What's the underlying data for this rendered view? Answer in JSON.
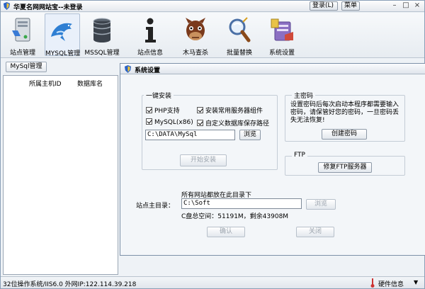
{
  "window": {
    "title": "华夏名网网站宝--未登录",
    "login_label": "登录(L)",
    "menu_label": "菜单",
    "min_glyph": "–",
    "max_glyph": "□",
    "close_glyph": "×"
  },
  "toolbar": {
    "items": [
      {
        "label": "站点管理",
        "icon": "server-icon"
      },
      {
        "label": "MYSQL管理",
        "icon": "dolphin-icon"
      },
      {
        "label": "MSSQL管理",
        "icon": "database-icon"
      },
      {
        "label": "站点信息",
        "icon": "info-icon"
      },
      {
        "label": "木马查杀",
        "icon": "horse-icon"
      },
      {
        "label": "批量替换",
        "icon": "magnifier-icon"
      },
      {
        "label": "系统设置",
        "icon": "settings-icon"
      }
    ],
    "active_index": 1
  },
  "left_panel": {
    "tab_label": "MySql管理",
    "columns": [
      "所属主机ID",
      "数据库名"
    ]
  },
  "dialog": {
    "title": "系统设置",
    "install_group": {
      "label": "一键安装",
      "options": [
        {
          "label": "PHP支持",
          "checked": true
        },
        {
          "label": "安装常用服务器组件",
          "checked": true
        },
        {
          "label": "MySQL(x86)",
          "checked": true
        },
        {
          "label": "自定义数据库保存路径",
          "checked": true
        }
      ],
      "path_value": "C:\\DATA\\MySql",
      "browse_label": "浏览",
      "start_label": "开始安装"
    },
    "master_password": {
      "label": "主密码",
      "description": "设置密码后每次启动本程序都需要输入密码，请保管好您的密码，一旦密码丢失无法恢复!",
      "create_label": "创建密码"
    },
    "ftp": {
      "label": "FTP",
      "repair_label": "修复FTP服务器"
    },
    "site_dir": {
      "note": "所有网站都放在此目录下",
      "label": "站点主目录：",
      "value": "C:\\Soft",
      "browse_label": "浏览",
      "disk_info": "C盘总空间：51191M，剩余43908M"
    },
    "ok_label": "确认",
    "close_label": "关闭"
  },
  "status_bar": {
    "text": "32位操作系统/IIS6.0 外网IP:122.114.39.218",
    "hardware_label": "硬件信息",
    "arrow_glyph": "▼"
  }
}
